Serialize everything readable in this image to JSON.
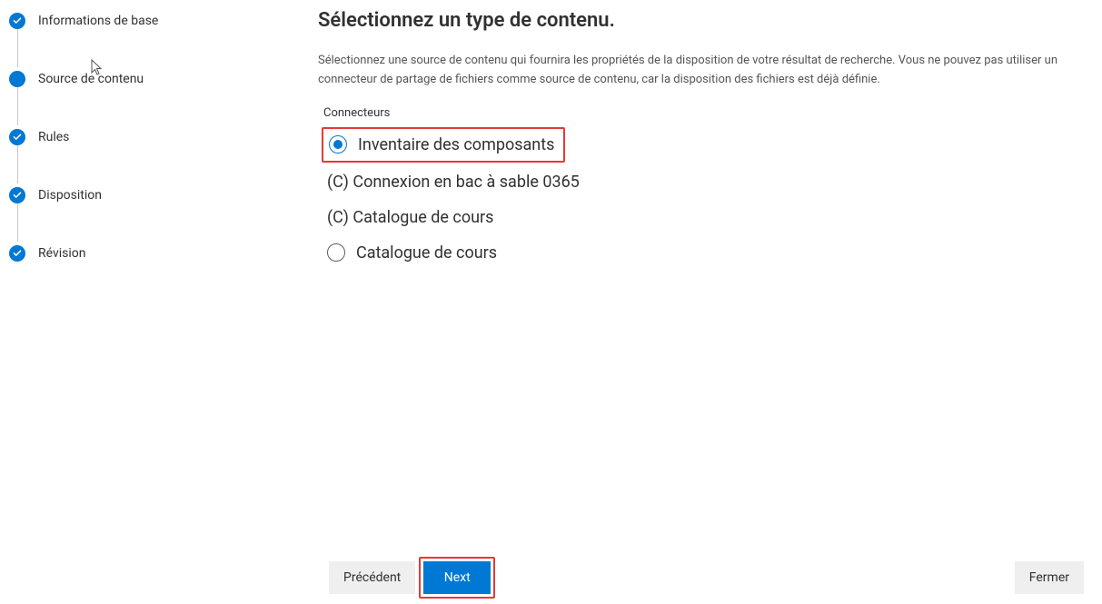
{
  "steps": [
    {
      "label": "Informations de base",
      "state": "done"
    },
    {
      "label": "Source de contenu",
      "state": "active"
    },
    {
      "label": "Rules",
      "state": "done"
    },
    {
      "label": "Disposition",
      "state": "done"
    },
    {
      "label": "Révision",
      "state": "done"
    }
  ],
  "main": {
    "title": "Sélectionnez un type de contenu.",
    "description": "Sélectionnez une source de contenu qui fournira les propriétés de la disposition de votre résultat de recherche. Vous ne pouvez pas utiliser un connecteur de partage de fichiers comme source de contenu, car la disposition des fichiers est déjà définie.",
    "field_label": "Connecteurs",
    "options": [
      {
        "label": "Inventaire des composants",
        "type": "radio",
        "selected": true,
        "highlighted": true
      },
      {
        "label": "(C) Connexion en bac à sable 0365",
        "type": "text"
      },
      {
        "label": "(C) Catalogue de cours",
        "type": "text"
      },
      {
        "label": "Catalogue de cours",
        "type": "radio",
        "selected": false
      }
    ]
  },
  "footer": {
    "back": "Précédent",
    "next": "Next",
    "close": "Fermer"
  }
}
